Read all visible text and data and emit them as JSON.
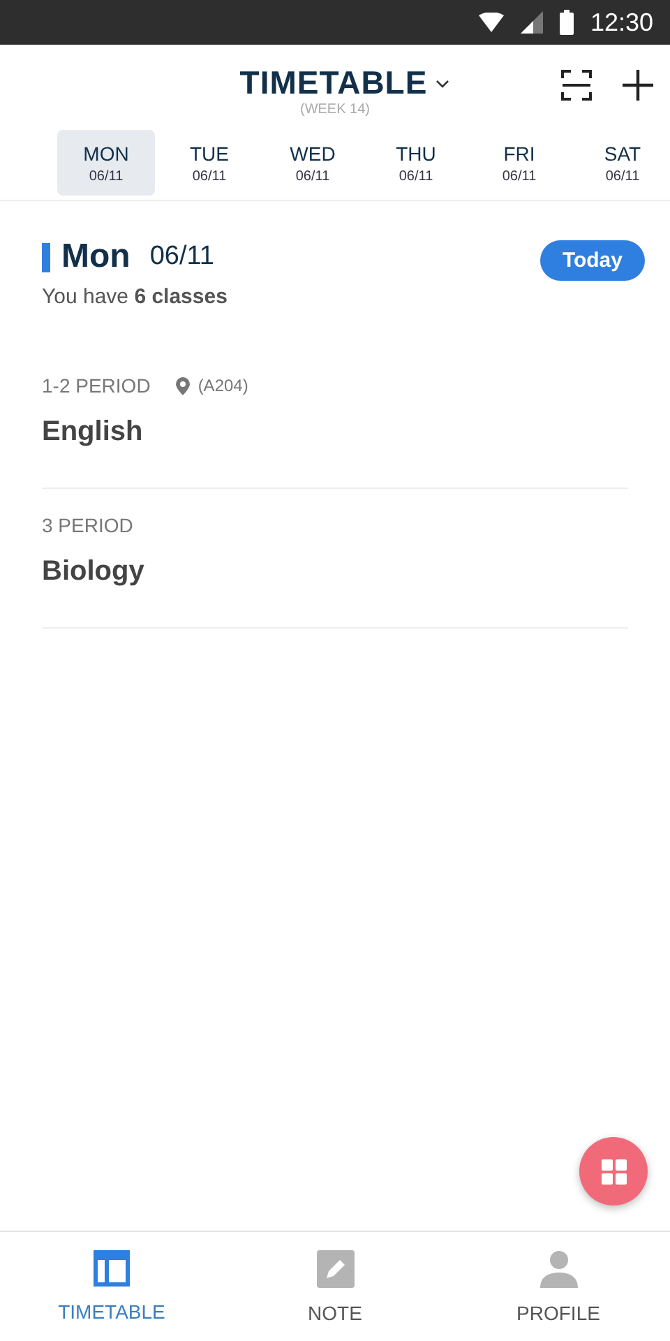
{
  "status_bar": {
    "time": "12:30"
  },
  "header": {
    "title": "TIMETABLE",
    "week": "(WEEK 14)"
  },
  "days": [
    {
      "name": "MON",
      "date": "06/11",
      "selected": true
    },
    {
      "name": "TUE",
      "date": "06/11",
      "selected": false
    },
    {
      "name": "WED",
      "date": "06/11",
      "selected": false
    },
    {
      "name": "THU",
      "date": "06/11",
      "selected": false
    },
    {
      "name": "FRI",
      "date": "06/11",
      "selected": false
    },
    {
      "name": "SAT",
      "date": "06/11",
      "selected": false
    }
  ],
  "day_summary": {
    "day": "Mon",
    "date": "06/11",
    "count_text": "You have **6 classes**",
    "today_button": "Today"
  },
  "classes": [
    {
      "period": "1-2 PERIOD",
      "location": "(A204)",
      "subject": "English"
    },
    {
      "period": "3 PERIOD",
      "subject": "Biology"
    }
  ],
  "bottom_nav": [
    {
      "kind": "timetable",
      "label": "TIMETABLE",
      "selected": true
    },
    {
      "kind": "note",
      "label": "NOTE",
      "selected": false
    },
    {
      "kind": "profile",
      "label": "PROFILE",
      "selected": false
    }
  ]
}
